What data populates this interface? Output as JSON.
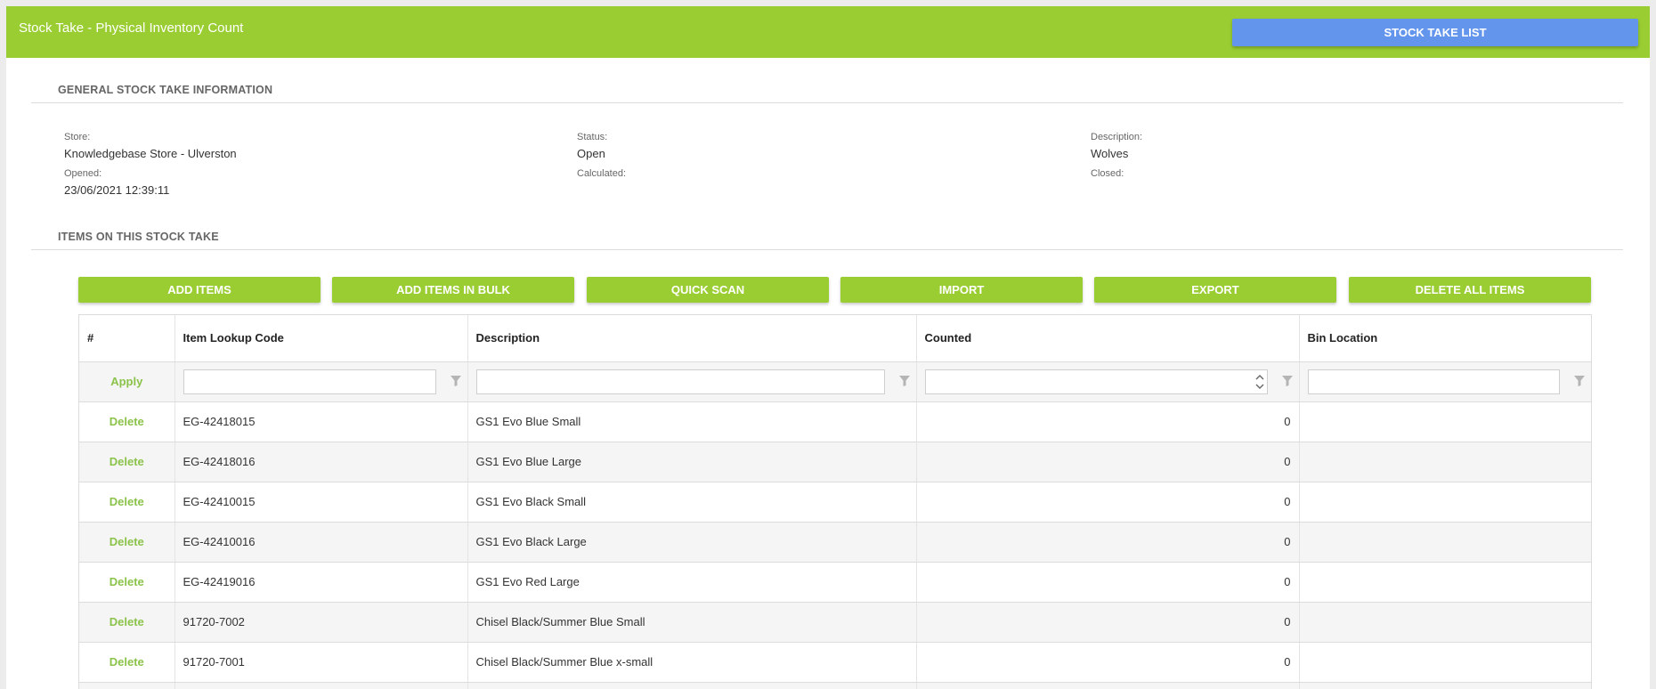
{
  "header": {
    "title": "Stock Take - Physical Inventory Count",
    "list_button": "STOCK TAKE LIST"
  },
  "general": {
    "section_title": "GENERAL STOCK TAKE INFORMATION",
    "store_label": "Store:",
    "store_value": "Knowledgebase Store - Ulverston",
    "opened_label": "Opened:",
    "opened_value": "23/06/2021 12:39:11",
    "status_label": "Status:",
    "status_value": "Open",
    "calculated_label": "Calculated:",
    "calculated_value": "",
    "description_label": "Description:",
    "description_value": "Wolves",
    "closed_label": "Closed:",
    "closed_value": ""
  },
  "items": {
    "section_title": "ITEMS ON THIS STOCK TAKE",
    "buttons": [
      "ADD ITEMS",
      "ADD ITEMS IN BULK",
      "QUICK SCAN",
      "IMPORT",
      "EXPORT",
      "DELETE ALL ITEMS"
    ],
    "columns": [
      "#",
      "Item Lookup Code",
      "Description",
      "Counted",
      "Bin Location"
    ],
    "apply_label": "Apply",
    "delete_label": "Delete",
    "rows": [
      {
        "code": "EG-42418015",
        "description": "GS1 Evo Blue Small",
        "counted": "0",
        "bin": ""
      },
      {
        "code": "EG-42418016",
        "description": "GS1 Evo Blue Large",
        "counted": "0",
        "bin": ""
      },
      {
        "code": "EG-42410015",
        "description": "GS1 Evo Black Small",
        "counted": "0",
        "bin": ""
      },
      {
        "code": "EG-42410016",
        "description": "GS1 Evo Black Large",
        "counted": "0",
        "bin": ""
      },
      {
        "code": "EG-42419016",
        "description": "GS1 Evo Red Large",
        "counted": "0",
        "bin": ""
      },
      {
        "code": "91720-7002",
        "description": "Chisel Black/Summer Blue Small",
        "counted": "0",
        "bin": ""
      },
      {
        "code": "91720-7001",
        "description": "Chisel Black/Summer Blue x-small",
        "counted": "0",
        "bin": ""
      },
      {
        "code": "",
        "description": "",
        "counted": "",
        "bin": ""
      }
    ]
  },
  "colors": {
    "brand_green": "#9acd32",
    "list_button_blue": "#6495ed",
    "link_green": "#8bc34a"
  }
}
